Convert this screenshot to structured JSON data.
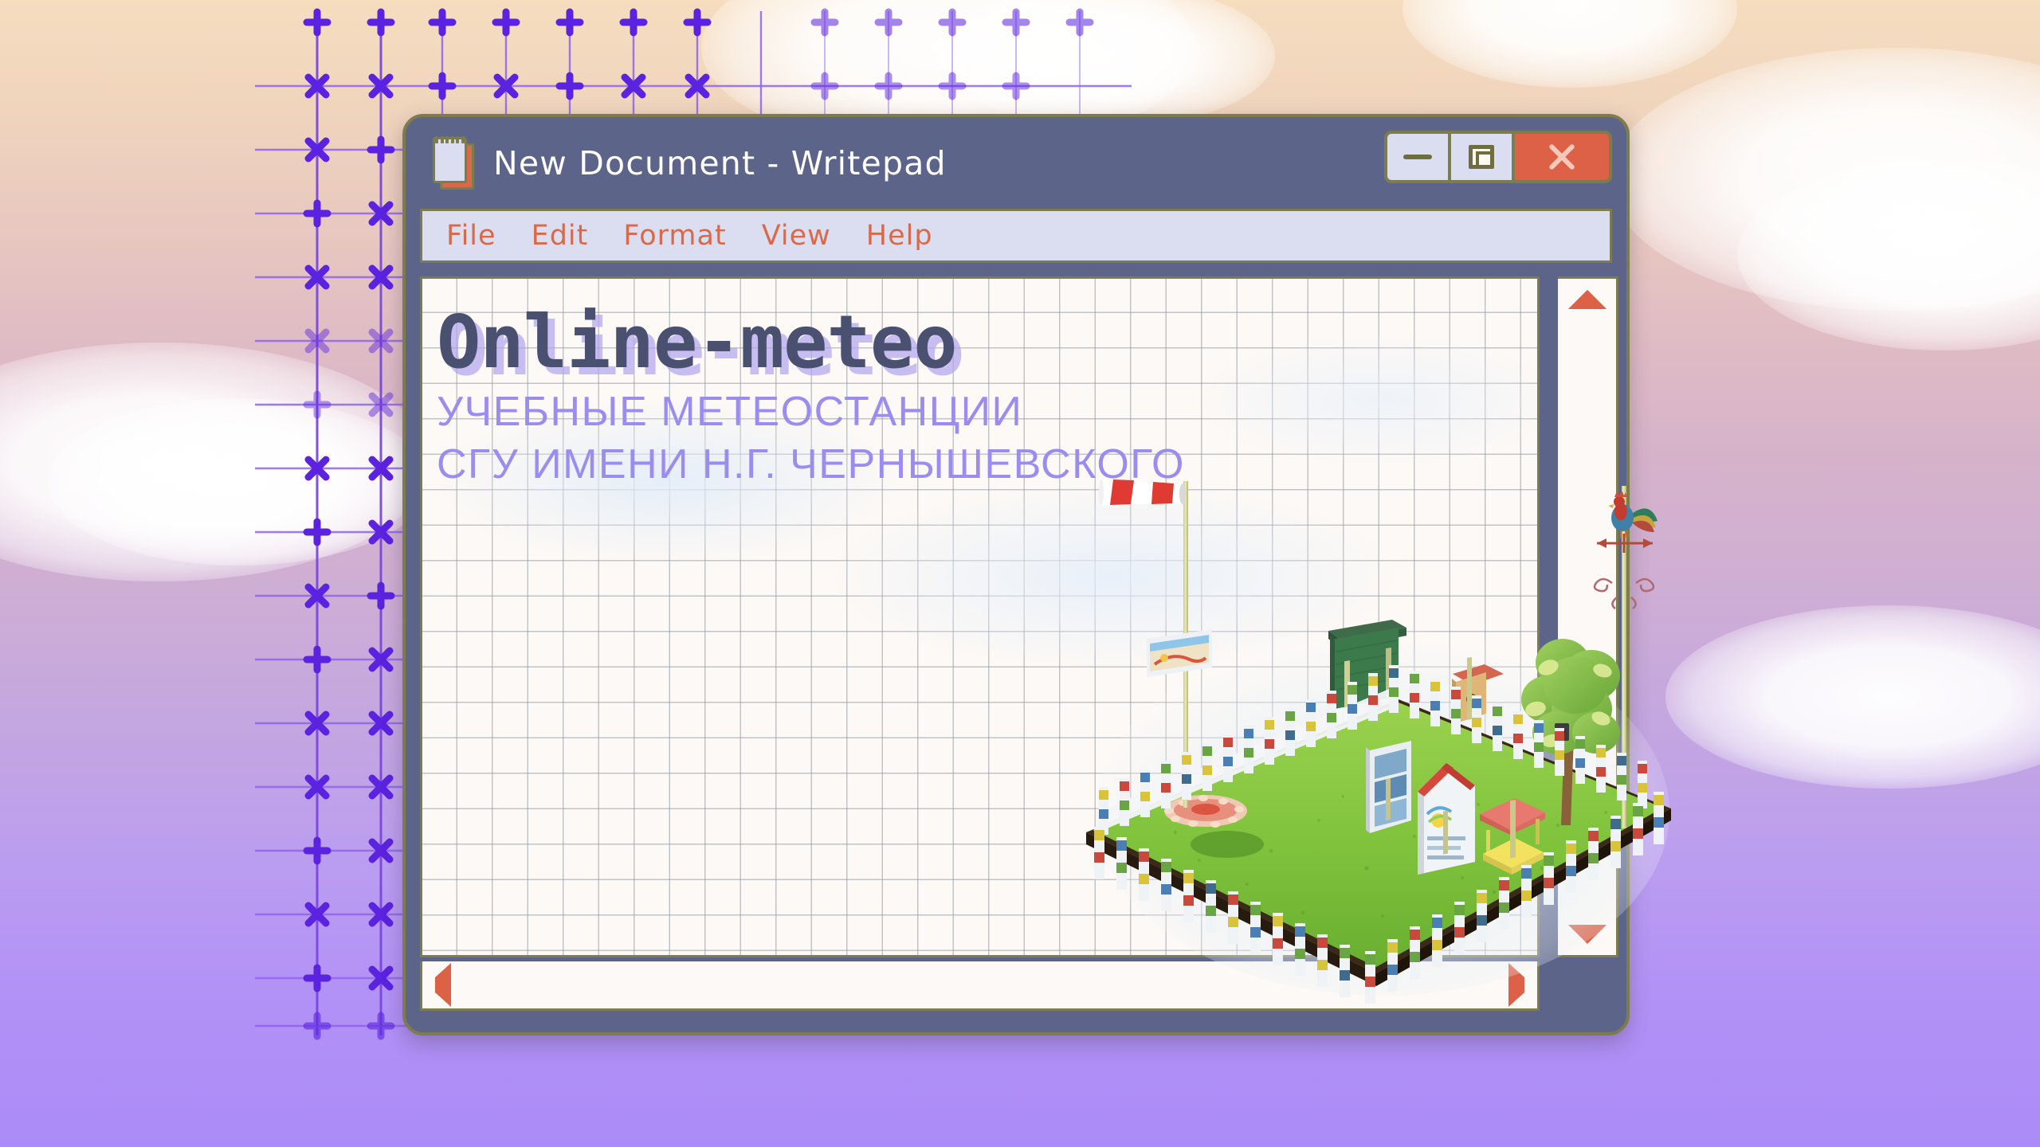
{
  "window": {
    "title": "New Document - Writepad",
    "icon": "notepad-icon",
    "controls": {
      "minimize_label": "—",
      "maximize_label": "□",
      "close_label": "✕"
    },
    "colors": {
      "frame": "#5c6489",
      "frame_border": "#7d7c4c",
      "titlebar_text": "#ffffff",
      "menu_text": "#d9694b",
      "menu_bg": "#dadef0",
      "close_button": "#dd6147",
      "paper": "#fdf9f6",
      "grid_line": "#94989e",
      "headline": "#4a5070",
      "headline_shadow": "#b0a4ee",
      "subtitle": "#9b8df0"
    }
  },
  "menubar": {
    "items": [
      {
        "label": "File"
      },
      {
        "label": "Edit"
      },
      {
        "label": "Format"
      },
      {
        "label": "View"
      },
      {
        "label": "Help"
      }
    ]
  },
  "document": {
    "headline": "Online-meteo",
    "subtitle_line_1": "УЧЕБНЫЕ МЕТЕОСТАНЦИИ",
    "subtitle_line_2": "СГУ ИМЕНИ Н.Г. ЧЕРНЫШЕВСКОГО",
    "illustration": "weather-station-model-diorama"
  },
  "scrollbars": {
    "vertical": {
      "up_arrow": "▲",
      "down_arrow": "▼"
    },
    "horizontal": {
      "left_arrow": "◀",
      "right_arrow": "▶"
    }
  },
  "desktop": {
    "wallpaper": "pastel-sky-with-clouds-gradient",
    "decoration": "violet-grid-overlay"
  }
}
